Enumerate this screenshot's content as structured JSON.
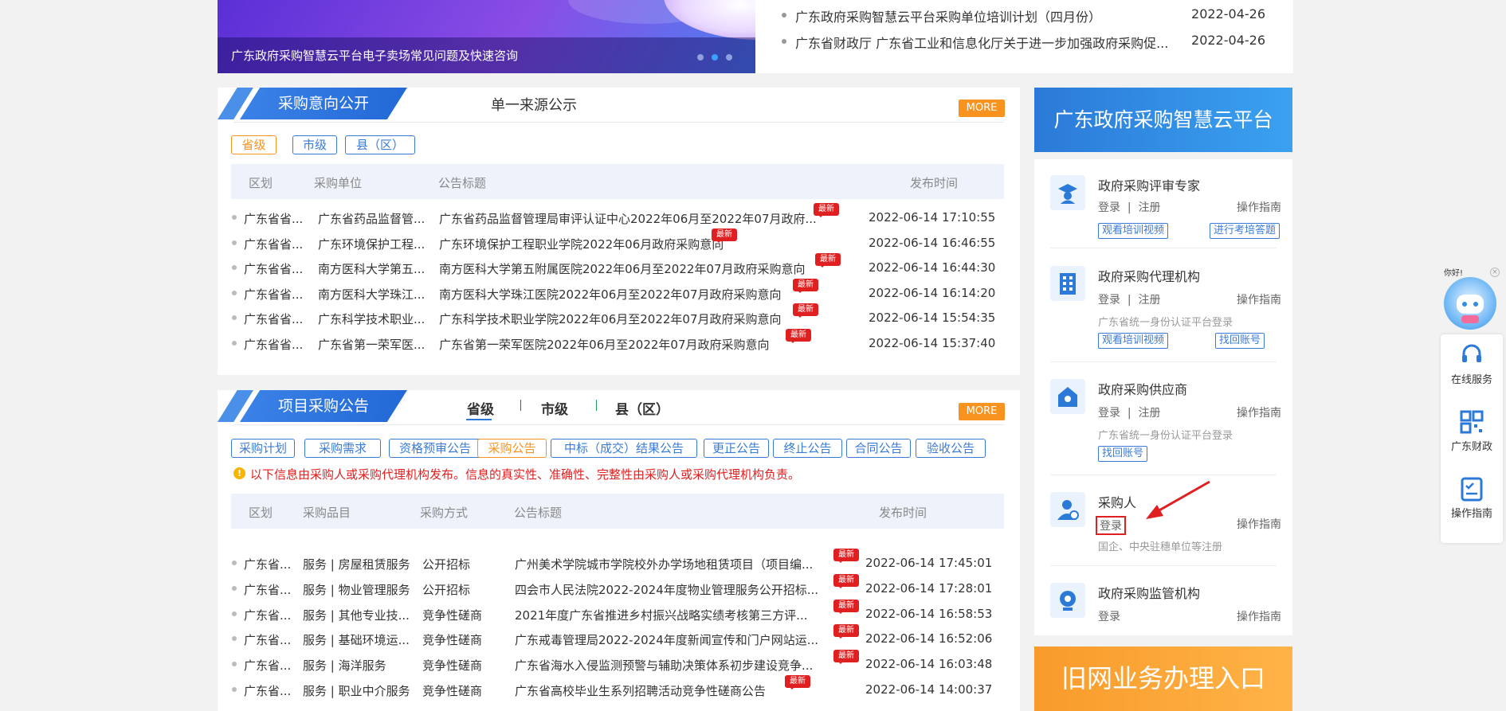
{
  "banner": {
    "caption": "广东政府采购智慧云平台电子卖场常见问题及快速咨询"
  },
  "top_news": [
    {
      "title": "广东政府采购智慧云平台采购单位培训计划（四月份）",
      "date": "2022-04-26"
    },
    {
      "title": "广东省财政厅 广东省工业和信息化厅关于进一步加强政府采购促...",
      "date": "2022-04-26"
    }
  ],
  "intent": {
    "title": "采购意向公开",
    "tab2": "单一来源公示",
    "more": "MORE",
    "levels": [
      "省级",
      "市级",
      "县（区）"
    ],
    "headers": {
      "region": "区划",
      "unit": "采购单位",
      "title": "公告标题",
      "time": "发布时间"
    },
    "new_label": "最新",
    "rows": [
      {
        "region": "广东省省...",
        "unit": "广东省药品监督管...",
        "title": "广东省药品监督管理局审评认证中心2022年06月至2022年07月政府...",
        "time": "2022-06-14 17:10:55"
      },
      {
        "region": "广东省省...",
        "unit": "广东环境保护工程...",
        "title": "广东环境保护工程职业学院2022年06月政府采购意向",
        "time": "2022-06-14 16:46:55"
      },
      {
        "region": "广东省省...",
        "unit": "南方医科大学第五...",
        "title": "南方医科大学第五附属医院2022年06月至2022年07月政府采购意向",
        "time": "2022-06-14 16:44:30"
      },
      {
        "region": "广东省省...",
        "unit": "南方医科大学珠江...",
        "title": "南方医科大学珠江医院2022年06月至2022年07月政府采购意向",
        "time": "2022-06-14 16:14:20"
      },
      {
        "region": "广东省省...",
        "unit": "广东科学技术职业...",
        "title": "广东科学技术职业学院2022年06月至2022年07月政府采购意向",
        "time": "2022-06-14 15:54:35"
      },
      {
        "region": "广东省省...",
        "unit": "广东省第一荣军医...",
        "title": "广东省第一荣军医院2022年06月至2022年07月政府采购意向",
        "time": "2022-06-14 15:37:40"
      }
    ]
  },
  "project": {
    "title": "项目采购公告",
    "levels": [
      "省级",
      "市级",
      "县（区）"
    ],
    "more": "MORE",
    "categories": [
      "采购计划",
      "采购需求",
      "资格预审公告",
      "采购公告",
      "中标（成交）结果公告",
      "更正公告",
      "终止公告",
      "合同公告",
      "验收公告"
    ],
    "notice": "以下信息由采购人或采购代理机构发布。信息的真实性、准确性、完整性由采购人或采购代理机构负责。",
    "headers": {
      "region": "区划",
      "item": "采购品目",
      "method": "采购方式",
      "title": "公告标题",
      "time": "发布时间"
    },
    "rows": [
      {
        "region": "广东省...",
        "item": "服务 | 房屋租赁服务",
        "method": "公开招标",
        "title": "广州美术学院城市学院校外办学场地租赁项目（项目编...",
        "time": "2022-06-14 17:45:01"
      },
      {
        "region": "广东省...",
        "item": "服务 | 物业管理服务",
        "method": "公开招标",
        "title": "四会市人民法院2022-2024年度物业管理服务公开招标...",
        "time": "2022-06-14 17:28:01"
      },
      {
        "region": "广东省...",
        "item": "服务 | 其他专业技...",
        "method": "竞争性磋商",
        "title": "2021年度广东省推进乡村振兴战略实绩考核第三方评...",
        "time": "2022-06-14 16:58:53"
      },
      {
        "region": "广东省...",
        "item": "服务 | 基础环境运...",
        "method": "竞争性磋商",
        "title": "广东戒毒管理局2022-2024年度新闻宣传和门户网站运...",
        "time": "2022-06-14 16:52:06"
      },
      {
        "region": "广东省...",
        "item": "服务 | 海洋服务",
        "method": "竞争性磋商",
        "title": "广东省海水入侵监测预警与辅助决策体系初步建设竞争...",
        "time": "2022-06-14 16:03:48"
      },
      {
        "region": "广东省...",
        "item": "服务 | 职业中介服务",
        "method": "竞争性磋商",
        "title": "广东省高校毕业生系列招聘活动竞争性磋商公告",
        "time": "2022-06-14 14:00:37"
      }
    ]
  },
  "platform": {
    "title": "广东政府采购智慧云平台"
  },
  "roles": {
    "login": "登录",
    "register": "注册",
    "guide": "操作指南",
    "expert": {
      "name": "政府采购评审专家",
      "btn1": "观看培训视频",
      "btn2": "进行考培答题"
    },
    "agency": {
      "name": "政府采购代理机构",
      "note": "广东省统一身份认证平台登录",
      "btn1": "观看培训视频",
      "btn2": "找回账号"
    },
    "supplier": {
      "name": "政府采购供应商",
      "note": "广东省统一身份认证平台登录",
      "btn1": "找回账号"
    },
    "purchaser": {
      "name": "采购人",
      "note": "国企、中央驻穗单位等注册"
    },
    "supervisor": {
      "name": "政府采购监管机构"
    }
  },
  "old_entry": {
    "title": "旧网业务办理入口"
  },
  "sidebar": {
    "greeting": "你好!",
    "items": [
      "在线服务",
      "广东财政",
      "操作指南"
    ]
  },
  "colors": {
    "accent_blue": "#2b7ad8",
    "accent_orange": "#f7931e",
    "badge_red": "#e02020",
    "highlight_red": "#e02020"
  }
}
